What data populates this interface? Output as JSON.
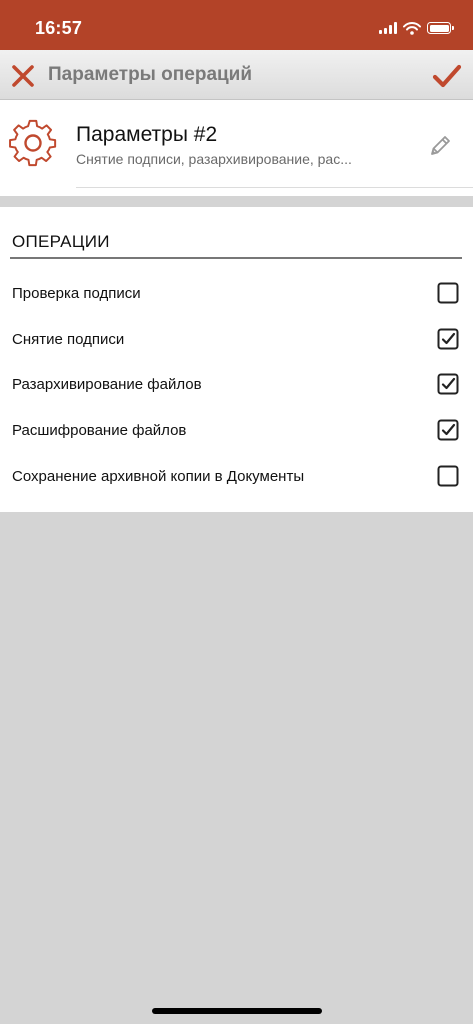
{
  "status_bar": {
    "time": "16:57"
  },
  "nav": {
    "title": "Параметры операций",
    "close_icon": "close-icon",
    "confirm_icon": "checkmark-icon",
    "accent_color": "#c0492e"
  },
  "profile": {
    "name": "Параметры #2",
    "subtitle": "Снятие подписи, разархивирование, рас...",
    "icon": "gear-icon",
    "edit_icon": "pencil-icon"
  },
  "operations": {
    "header": "ОПЕРАЦИИ",
    "items": [
      {
        "label": "Проверка подписи",
        "checked": false
      },
      {
        "label": "Снятие подписи",
        "checked": true
      },
      {
        "label": "Разархивирование файлов",
        "checked": true
      },
      {
        "label": "Расшифрование файлов",
        "checked": true
      },
      {
        "label": "Сохранение архивной копии в Документы",
        "checked": false
      }
    ]
  },
  "colors": {
    "status_bar": "#b34328",
    "accent": "#c0492e",
    "background": "#d4d4d4"
  }
}
